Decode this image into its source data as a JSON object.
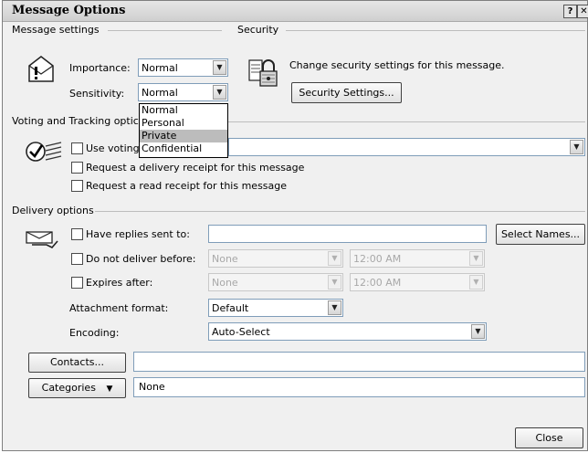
{
  "window": {
    "title": "Message Options",
    "help_glyph": "?",
    "close_glyph": "✕"
  },
  "message_settings": {
    "heading": "Message settings",
    "importance_label": "Importance:",
    "importance_value": "Normal",
    "sensitivity_label": "Sensitivity:",
    "sensitivity_value": "Normal",
    "sensitivity_options": [
      "Normal",
      "Personal",
      "Private",
      "Confidential"
    ],
    "sensitivity_highlighted": "Private"
  },
  "security": {
    "heading": "Security",
    "description": "Change security settings for this message.",
    "button_label": "Security Settings..."
  },
  "voting": {
    "heading": "Voting and Tracking optic",
    "use_voting_label": "Use voting",
    "delivery_receipt_label": "Request a delivery receipt for this message",
    "read_receipt_label": "Request a read receipt for this message"
  },
  "delivery": {
    "heading": "Delivery options",
    "have_replies_label": "Have replies sent to:",
    "have_replies_value": "",
    "select_names_label": "Select Names...",
    "do_not_deliver_label": "Do not deliver before:",
    "do_not_deliver_date": "None",
    "do_not_deliver_time": "12:00 AM",
    "expires_label": "Expires after:",
    "expires_date": "None",
    "expires_time": "12:00 AM",
    "attachment_format_label": "Attachment format:",
    "attachment_format_value": "Default",
    "encoding_label": "Encoding:",
    "encoding_value": "Auto-Select"
  },
  "contacts": {
    "button_label": "Contacts...",
    "value": ""
  },
  "categories": {
    "button_label": "Categories",
    "value": "None"
  },
  "footer": {
    "close_label": "Close"
  },
  "glyphs": {
    "dropdown_arrow": "▼"
  }
}
